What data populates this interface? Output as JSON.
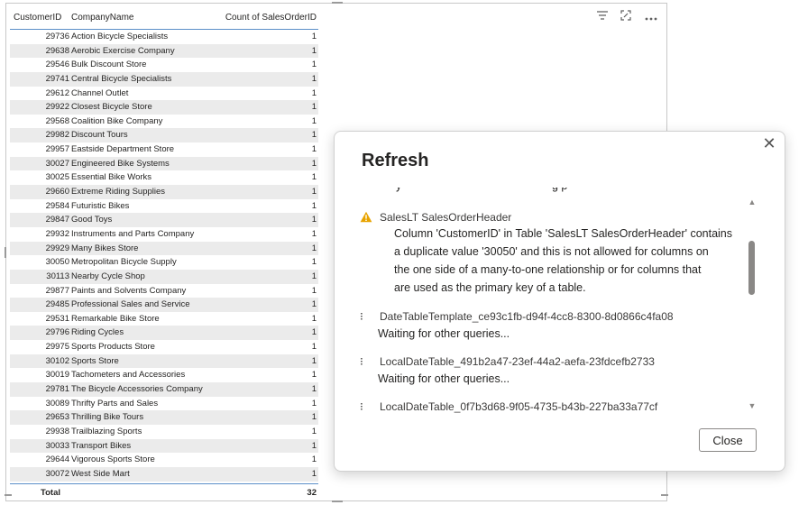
{
  "table": {
    "headers": {
      "customer_id": "CustomerID",
      "company": "CompanyName",
      "count": "Count of SalesOrderID"
    },
    "rows": [
      {
        "id": "29736",
        "name": "Action Bicycle Specialists",
        "count": "1"
      },
      {
        "id": "29638",
        "name": "Aerobic Exercise Company",
        "count": "1"
      },
      {
        "id": "29546",
        "name": "Bulk Discount Store",
        "count": "1"
      },
      {
        "id": "29741",
        "name": "Central Bicycle Specialists",
        "count": "1"
      },
      {
        "id": "29612",
        "name": "Channel Outlet",
        "count": "1"
      },
      {
        "id": "29922",
        "name": "Closest Bicycle Store",
        "count": "1"
      },
      {
        "id": "29568",
        "name": "Coalition Bike Company",
        "count": "1"
      },
      {
        "id": "29982",
        "name": "Discount Tours",
        "count": "1"
      },
      {
        "id": "29957",
        "name": "Eastside Department Store",
        "count": "1"
      },
      {
        "id": "30027",
        "name": "Engineered Bike Systems",
        "count": "1"
      },
      {
        "id": "30025",
        "name": "Essential Bike Works",
        "count": "1"
      },
      {
        "id": "29660",
        "name": "Extreme Riding Supplies",
        "count": "1"
      },
      {
        "id": "29584",
        "name": "Futuristic Bikes",
        "count": "1"
      },
      {
        "id": "29847",
        "name": "Good Toys",
        "count": "1"
      },
      {
        "id": "29932",
        "name": "Instruments and Parts Company",
        "count": "1"
      },
      {
        "id": "29929",
        "name": "Many Bikes Store",
        "count": "1"
      },
      {
        "id": "30050",
        "name": "Metropolitan Bicycle Supply",
        "count": "1"
      },
      {
        "id": "30113",
        "name": "Nearby Cycle Shop",
        "count": "1"
      },
      {
        "id": "29877",
        "name": "Paints and Solvents Company",
        "count": "1"
      },
      {
        "id": "29485",
        "name": "Professional Sales and Service",
        "count": "1"
      },
      {
        "id": "29531",
        "name": "Remarkable Bike Store",
        "count": "1"
      },
      {
        "id": "29796",
        "name": "Riding Cycles",
        "count": "1"
      },
      {
        "id": "29975",
        "name": "Sports Products Store",
        "count": "1"
      },
      {
        "id": "30102",
        "name": "Sports Store",
        "count": "1"
      },
      {
        "id": "30019",
        "name": "Tachometers and Accessories",
        "count": "1"
      },
      {
        "id": "29781",
        "name": "The Bicycle Accessories Company",
        "count": "1"
      },
      {
        "id": "30089",
        "name": "Thrifty Parts and Sales",
        "count": "1"
      },
      {
        "id": "29653",
        "name": "Thrilling Bike Tours",
        "count": "1"
      },
      {
        "id": "29938",
        "name": "Trailblazing Sports",
        "count": "1"
      },
      {
        "id": "30033",
        "name": "Transport Bikes",
        "count": "1"
      },
      {
        "id": "29644",
        "name": "Vigorous Sports Store",
        "count": "1"
      },
      {
        "id": "30072",
        "name": "West Side Mart",
        "count": "1"
      }
    ],
    "total": {
      "label": "Total",
      "value": "32"
    }
  },
  "toolbar": {
    "filter_icon": "filter-icon",
    "focus_icon": "focus-mode-icon",
    "more_icon": "more-options-icon"
  },
  "dialog": {
    "title": "Refresh",
    "error": {
      "table": "SalesLT SalesOrderHeader",
      "message_lines": [
        "Column 'CustomerID' in Table 'SalesLT SalesOrderHeader' contains",
        "a duplicate value '30050' and this is not allowed for columns on",
        "the one side of a many-to-one relationship or for columns that",
        "are used as the primary key of a table."
      ]
    },
    "queries": [
      {
        "name": "DateTableTemplate_ce93c1fb-d94f-4cc8-8300-8d0866c4fa08",
        "status": "Waiting for other queries..."
      },
      {
        "name": "LocalDateTable_491b2a47-23ef-44a2-aefa-23fdcefb2733",
        "status": "Waiting for other queries..."
      },
      {
        "name": "LocalDateTable_0f7b3d68-9f05-4735-b43b-227ba33a77cf",
        "status": ""
      }
    ],
    "close_label": "Close",
    "colors": {
      "warning": "#e8a300",
      "accent_line": "#5b8fc8"
    }
  }
}
